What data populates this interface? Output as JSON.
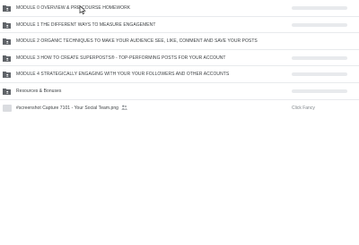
{
  "folders": [
    {
      "name": "MODULE 0 OVERVIEW & PRE-COURSE HOMEWORK",
      "icon": "shared-folder-icon"
    },
    {
      "name": "MODULE 1 THE DIFFERENT WAYS TO MEASURE ENGAGEMENT",
      "icon": "shared-folder-icon"
    },
    {
      "name": "MODULE 2 ORGANIC TECHNIQUES TO MAKE YOUR AUDIENCE SEE, LIKE, COMMENT AND SAVE YOUR POSTS",
      "icon": "shared-folder-icon"
    },
    {
      "name": "MODULE 3 HOW TO CREATE SUPERPOSTS® - TOP-PERFORMING POSTS FOR YOUR ACCOUNT",
      "icon": "shared-folder-icon"
    },
    {
      "name": "MODULE 4 STRATEGICALLY ENGAGING WITH YOUR YOUR FOLLOWERS AND OTHER ACCOUNTS",
      "icon": "shared-folder-icon"
    },
    {
      "name": "Resources & Bonuses",
      "icon": "shared-folder-icon"
    }
  ],
  "file": {
    "name": "#screenshot Capture 7101 - Your Social Team.png",
    "owner": "Click Fancy",
    "icon": "image-file-icon",
    "shared_icon": "people-icon"
  },
  "colors": {
    "folder": "#5f6368",
    "placeholder": "#e8eaed",
    "divider": "#e8eaed"
  }
}
